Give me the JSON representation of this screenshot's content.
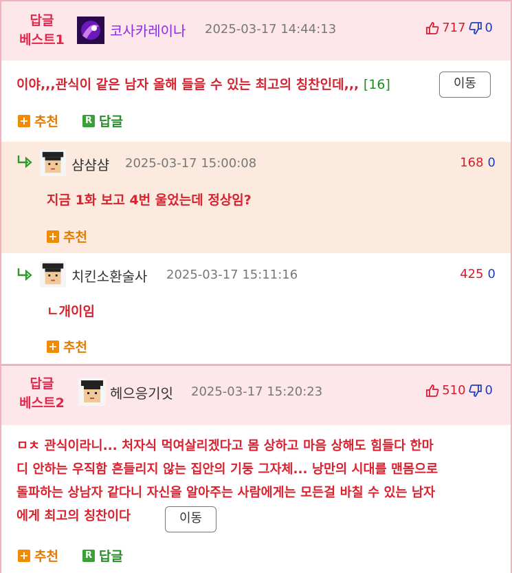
{
  "best1": {
    "label": "답글\n베스트1",
    "label_line1": "답글",
    "label_line2": "베스트1",
    "nick": "코사카레이나",
    "date": "2025-03-17 14:44:13",
    "up": "717",
    "down": "0",
    "text": "이야,,,관식이 같은 남자 올해 들을 수 있는 최고의 칭찬인데,,,",
    "count": "[16]",
    "move": "이동",
    "recommend": "추천",
    "reply": "답글"
  },
  "reply1": {
    "nick": "샴샴샴",
    "date": "2025-03-17 15:00:08",
    "up": "168",
    "down": "0",
    "text": "지금 1화 보고 4번 울었는데 정상임?",
    "recommend": "추천"
  },
  "reply2": {
    "nick": "치킨소환술사",
    "date": "2025-03-17 15:11:16",
    "up": "425",
    "down": "0",
    "text": "ㄴ개이임",
    "recommend": "추천"
  },
  "best2": {
    "label_line1": "답글",
    "label_line2": "베스트2",
    "nick": "헤으응기잇",
    "date": "2025-03-17 15:20:23",
    "up": "510",
    "down": "0",
    "text_line1": "ㅁㅊ 관식이라니... 처자식 먹여살리겠다고 몸 상하고 마음 상해도 힘들다 한마",
    "text_line2": "디 안하는 우직함 흔들리지 않는 집안의 기둥 그자체... 낭만의 시대를 맨몸으로",
    "text_line3": "돌파하는 상남자 같다니 자신을 알아주는 사람에게는 모든걸 바칠 수 있는 남자",
    "text_line4": "에게 최고의 칭찬이다",
    "move": "이동",
    "recommend": "추천",
    "reply": "답글"
  },
  "colors": {
    "accent_red": "#d8222f",
    "best_bg": "#fde7ea",
    "reply_bg": "#fbeadd",
    "border_pink": "#f3b3bd",
    "recommend_orange": "#f08a00",
    "reply_green": "#3aa03a"
  },
  "icons": [
    "thumbs-up-icon",
    "thumbs-down-icon",
    "reply-arrow-icon",
    "plus-icon",
    "r-icon"
  ]
}
